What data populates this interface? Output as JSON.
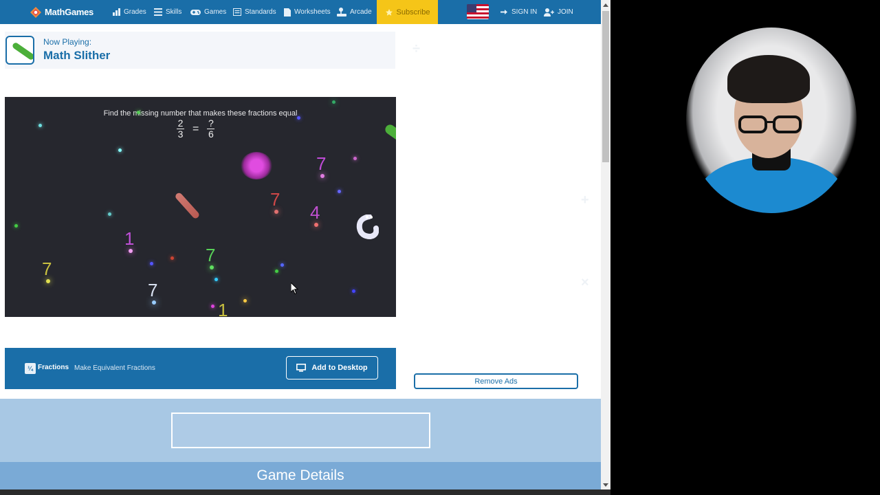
{
  "nav": {
    "logo": "MathGames",
    "items": [
      {
        "label": "Grades",
        "icon": "grades-icon"
      },
      {
        "label": "Skills",
        "icon": "skills-icon"
      },
      {
        "label": "Games",
        "icon": "gamepad-icon"
      },
      {
        "label": "Standards",
        "icon": "standards-icon"
      },
      {
        "label": "Worksheets",
        "icon": "worksheet-icon"
      },
      {
        "label": "Arcade",
        "icon": "joystick-icon"
      }
    ],
    "subscribe": "Subscribe",
    "sign_in": "SIGN IN",
    "join": "JOIN"
  },
  "header": {
    "now_playing_label": "Now Playing:",
    "game_title": "Math Slither"
  },
  "game": {
    "prompt": "Find the missing number that makes these fractions equal",
    "equation": {
      "left": {
        "numerator": "2",
        "denominator": "3"
      },
      "equals": "=",
      "right": {
        "numerator": "?",
        "denominator": "6"
      }
    },
    "numbers": [
      "7",
      "7",
      "4",
      "1",
      "7",
      "7",
      "7",
      "1"
    ]
  },
  "game_bar": {
    "icon_text": "¼",
    "skill": "Fractions",
    "subskill": "Make Equivalent Fractions",
    "add_to_desktop": "Add to Desktop"
  },
  "remove_ads": "Remove Ads",
  "game_details": "Game Details",
  "colors": {
    "brand_blue": "#1a6ea8",
    "subscribe_yellow": "#f5c518",
    "lower_bg": "#a8c8e4",
    "details_bg": "#7aaad6"
  }
}
